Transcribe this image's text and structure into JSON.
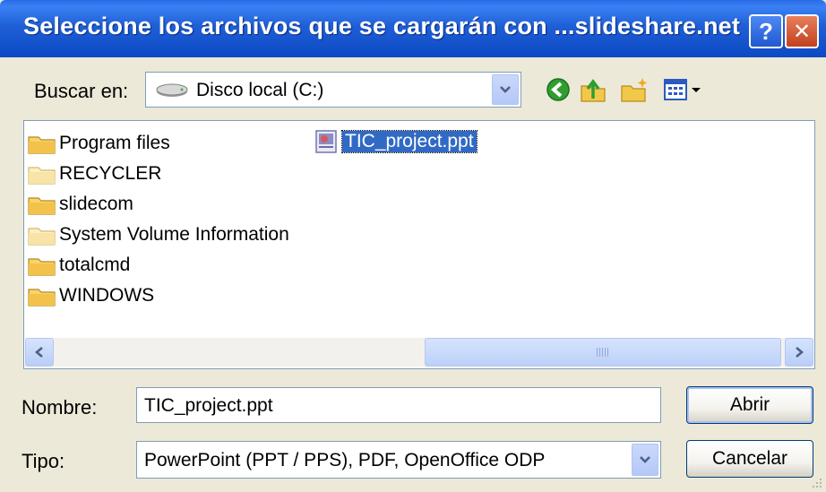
{
  "window": {
    "title": "Seleccione los archivos que se cargarán con ...slideshare.net",
    "help_glyph": "?",
    "close_glyph": "✕"
  },
  "look_in": {
    "label": "Buscar en:",
    "value": "Disco local (C:)",
    "drive_icon": "hard-drive-icon"
  },
  "toolbar": {
    "icons": [
      "back-icon",
      "up-folder-icon",
      "new-folder-icon",
      "view-menu-icon"
    ]
  },
  "file_list": {
    "folders": [
      {
        "name": "Program files"
      },
      {
        "name": "RECYCLER"
      },
      {
        "name": "slidecom"
      },
      {
        "name": "System Volume Information"
      },
      {
        "name": "totalcmd"
      },
      {
        "name": "WINDOWS"
      }
    ],
    "files": [
      {
        "name": "TIC_project.ppt",
        "selected": true
      }
    ]
  },
  "filename": {
    "label": "Nombre:",
    "value": "TIC_project.ppt"
  },
  "filetype": {
    "label": "Tipo:",
    "value": "PowerPoint (PPT / PPS), PDF, OpenOffice ODP"
  },
  "buttons": {
    "open": "Abrir",
    "cancel": "Cancelar"
  },
  "colors": {
    "titlebar": "#0C49C3",
    "selection": "#316AC5",
    "dialog_bg": "#ECE9D8"
  }
}
